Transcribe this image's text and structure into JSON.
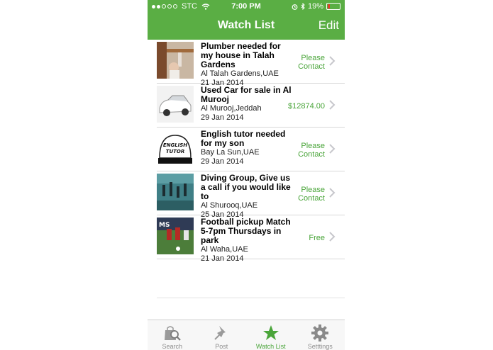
{
  "status_bar": {
    "carrier": "STC",
    "time": "7:00 PM",
    "battery": "19%",
    "battery_level": 0.19
  },
  "nav": {
    "title": "Watch List",
    "edit_label": "Edit"
  },
  "items": [
    {
      "title": "Plumber needed for my house in Talah Gardens",
      "location": "Al Talah Gardens,UAE",
      "date": "21 Jan 2014",
      "price": "Please Contact",
      "thumb_icon": "plumbing-photo"
    },
    {
      "title": "Used Car for sale in Al Murooj",
      "location": "Al Murooj,Jeddah",
      "date": "29 Jan 2014",
      "price": "$12874.00",
      "thumb_icon": "white-car-photo"
    },
    {
      "title": "English tutor needed for my son",
      "location": "Bay La Sun,UAE",
      "date": "29 Jan 2014",
      "price": "Please Contact",
      "thumb_icon": "english-tutor-cap-photo",
      "thumb_text": "ENGLISH TUTOR"
    },
    {
      "title": "Diving Group, Give us a call if you would like to",
      "location": "Al Shurooq,UAE",
      "date": "25 Jan 2014",
      "price": "Please Contact",
      "thumb_icon": "divers-photo"
    },
    {
      "title": "Football pickup Match 5-7pm Thursdays in park",
      "location": "Al Waha,UAE",
      "date": "21 Jan 2014",
      "price": "Free",
      "thumb_icon": "football-photo",
      "thumb_text": "MS"
    }
  ],
  "tabs": [
    {
      "label": "Search",
      "icon": "search-bag-icon",
      "active": false
    },
    {
      "label": "Post",
      "icon": "pin-icon",
      "active": false
    },
    {
      "label": "Watch List",
      "icon": "star-icon",
      "active": true
    },
    {
      "label": "Setttings",
      "icon": "gear-icon",
      "active": false
    }
  ],
  "colors": {
    "accent": "#5aae44",
    "price_green": "#4aa53a",
    "battery_red": "#e23c2c"
  }
}
